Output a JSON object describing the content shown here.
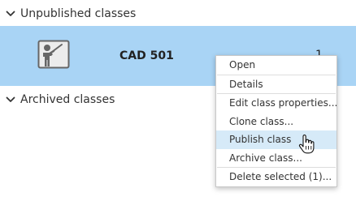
{
  "sections": {
    "unpublished": {
      "title": "Unpublished classes",
      "icon": "chevron-down-icon"
    },
    "archived": {
      "title": "Archived classes",
      "icon": "chevron-down-icon"
    }
  },
  "class_row": {
    "name": "CAD 501",
    "count": "1",
    "icon": "teacher-at-board-icon",
    "selected": true
  },
  "context_menu": {
    "items": [
      {
        "label": "Open"
      },
      {
        "label": "Details"
      },
      {
        "label": "Edit class properties..."
      },
      {
        "label": "Clone class..."
      },
      {
        "label": "Publish class",
        "hovered": true
      },
      {
        "label": "Archive class..."
      },
      {
        "label": "Delete selected (1)..."
      }
    ]
  },
  "colors": {
    "selected_row": "#a9d4f5",
    "menu_hover": "#d6eaf8",
    "text": "#333333"
  },
  "cursor": "hand-pointer-icon"
}
